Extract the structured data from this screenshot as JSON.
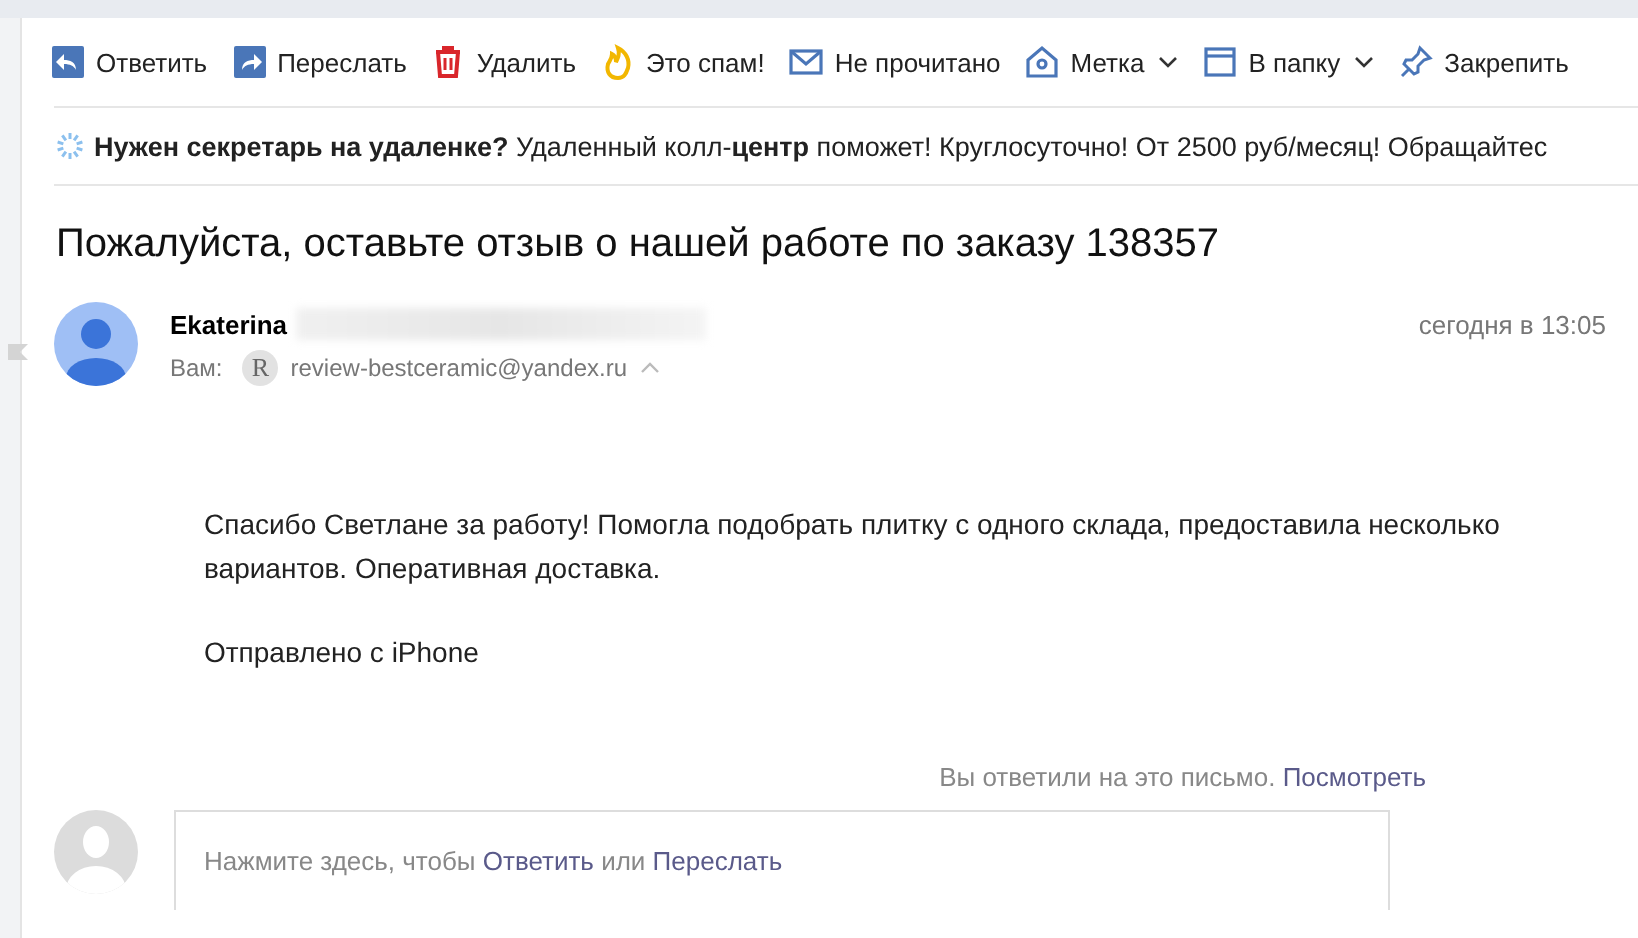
{
  "toolbar": [
    {
      "kind": "reply",
      "label": "Ответить",
      "dropdown": false
    },
    {
      "kind": "forward",
      "label": "Переслать",
      "dropdown": false
    },
    {
      "kind": "delete",
      "label": "Удалить",
      "dropdown": false
    },
    {
      "kind": "spam",
      "label": "Это спам!",
      "dropdown": false
    },
    {
      "kind": "unread",
      "label": "Не прочитано",
      "dropdown": false
    },
    {
      "kind": "label",
      "label": "Метка",
      "dropdown": true
    },
    {
      "kind": "folder",
      "label": "В папку",
      "dropdown": true
    },
    {
      "kind": "pin",
      "label": "Закрепить",
      "dropdown": false
    }
  ],
  "ad": {
    "text": "**Нужен секретарь на удаленке?** Удаленный колл-**центр** поможет! Круглосуточно! От 2500 руб/месяц! Обращайтес"
  },
  "subject": "Пожалуйста, оставьте отзыв о нашей работе по заказу 138357",
  "message": {
    "sender": "Ekaterina",
    "to_label": "Вам:",
    "recipient_initial": "R",
    "recipient": "review-bestceramic@yandex.ru",
    "date": "сегодня в 13:05",
    "body": [
      "Спасибо Светлане за работу! Помогла подобрать плитку с одного склада, предоставила несколько вариантов. Оперативная доставка.",
      "Отправлено с iPhone"
    ]
  },
  "replied": {
    "text": "Вы ответили на это письмо.",
    "link": "Посмотреть"
  },
  "quick_reply": {
    "prefix": "Нажмите здесь, чтобы",
    "reply_link": "Ответить",
    "middle": "или",
    "forward_link": "Переслать"
  }
}
